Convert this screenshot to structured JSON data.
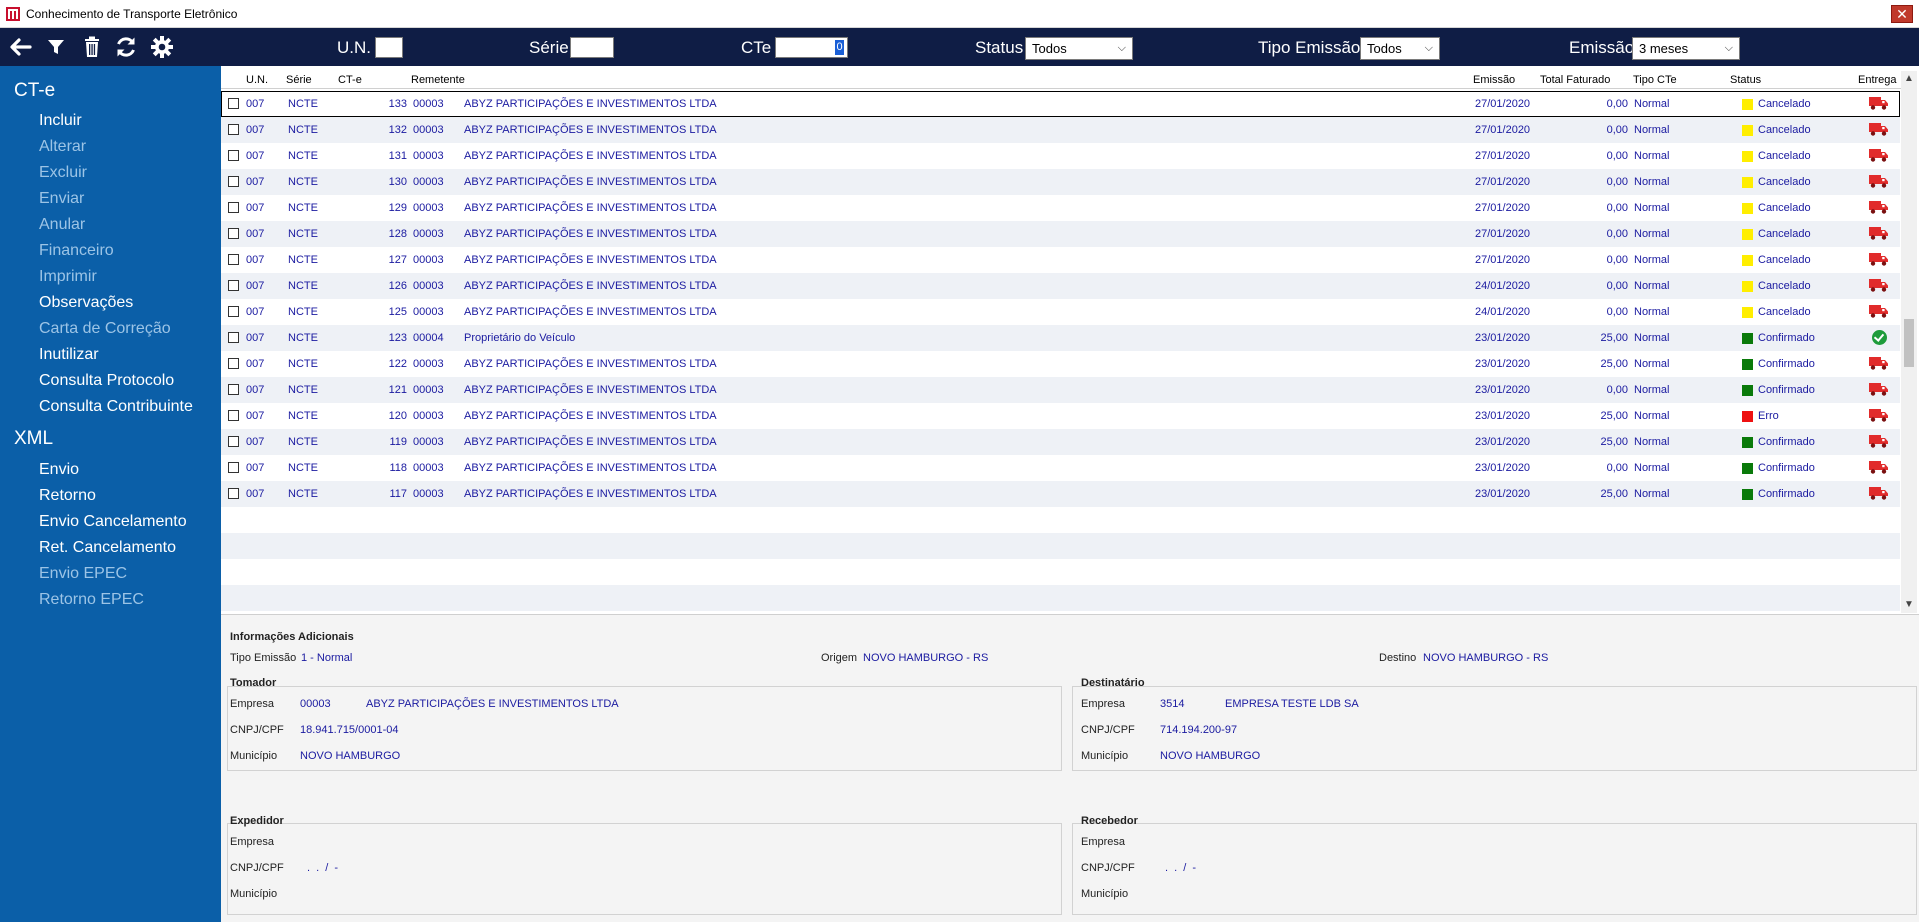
{
  "window": {
    "title": "Conhecimento de Transporte Eletrônico",
    "close_glyph": "✕"
  },
  "toolbar": {
    "icons": [
      "back-arrow-icon",
      "filter-icon",
      "trash-icon",
      "refresh-icon",
      "gear-icon"
    ],
    "un_label": "U.N.",
    "un_value": "",
    "serie_label": "Série",
    "serie_value": "",
    "cte_label": "CTe",
    "cte_value": "0",
    "status_label": "Status",
    "status_value": "Todos",
    "tipo_label": "Tipo Emissão",
    "tipo_value": "Todos",
    "emissao_label": "Emissão",
    "emissao_value": "3 meses"
  },
  "sidebar": {
    "cte_title": "CT-e",
    "cte_items": [
      {
        "label": "Incluir",
        "enabled": true
      },
      {
        "label": "Alterar",
        "enabled": false
      },
      {
        "label": "Excluir",
        "enabled": false
      },
      {
        "label": "Enviar",
        "enabled": false
      },
      {
        "label": "Anular",
        "enabled": false
      },
      {
        "label": "Financeiro",
        "enabled": false
      },
      {
        "label": "Imprimir",
        "enabled": false
      },
      {
        "label": "Observações",
        "enabled": true
      },
      {
        "label": "Carta de Correção",
        "enabled": false
      },
      {
        "label": "Inutilizar",
        "enabled": true
      },
      {
        "label": "Consulta Protocolo",
        "enabled": true
      },
      {
        "label": "Consulta Contribuinte",
        "enabled": true
      }
    ],
    "xml_title": "XML",
    "xml_items": [
      {
        "label": "Envio",
        "enabled": true
      },
      {
        "label": "Retorno",
        "enabled": true
      },
      {
        "label": "Envio Cancelamento",
        "enabled": true
      },
      {
        "label": "Ret. Cancelamento",
        "enabled": true
      },
      {
        "label": "Envio EPEC",
        "enabled": false
      },
      {
        "label": "Retorno EPEC",
        "enabled": false
      }
    ]
  },
  "grid": {
    "columns": [
      "U.N.",
      "Série",
      "CT-e",
      "Remetente",
      "Emissão",
      "Total Faturado",
      "Tipo CTe",
      "Status",
      "Entrega"
    ],
    "status_colors": {
      "Cancelado": "#ffee00",
      "Confirmado": "#0a7a0a",
      "Erro": "#ee1111"
    },
    "rows": [
      {
        "un": "007",
        "serie": "NCTE",
        "cte": "133",
        "code": "00003",
        "name": "ABYZ PARTICIPAÇÕES E INVESTIMENTOS LTDA",
        "emissao": "27/01/2020",
        "total": "0,00",
        "tipo": "Normal",
        "status": "Cancelado",
        "entrega": "truck"
      },
      {
        "un": "007",
        "serie": "NCTE",
        "cte": "132",
        "code": "00003",
        "name": "ABYZ PARTICIPAÇÕES E INVESTIMENTOS LTDA",
        "emissao": "27/01/2020",
        "total": "0,00",
        "tipo": "Normal",
        "status": "Cancelado",
        "entrega": "truck"
      },
      {
        "un": "007",
        "serie": "NCTE",
        "cte": "131",
        "code": "00003",
        "name": "ABYZ PARTICIPAÇÕES E INVESTIMENTOS LTDA",
        "emissao": "27/01/2020",
        "total": "0,00",
        "tipo": "Normal",
        "status": "Cancelado",
        "entrega": "truck"
      },
      {
        "un": "007",
        "serie": "NCTE",
        "cte": "130",
        "code": "00003",
        "name": "ABYZ PARTICIPAÇÕES E INVESTIMENTOS LTDA",
        "emissao": "27/01/2020",
        "total": "0,00",
        "tipo": "Normal",
        "status": "Cancelado",
        "entrega": "truck"
      },
      {
        "un": "007",
        "serie": "NCTE",
        "cte": "129",
        "code": "00003",
        "name": "ABYZ PARTICIPAÇÕES E INVESTIMENTOS LTDA",
        "emissao": "27/01/2020",
        "total": "0,00",
        "tipo": "Normal",
        "status": "Cancelado",
        "entrega": "truck"
      },
      {
        "un": "007",
        "serie": "NCTE",
        "cte": "128",
        "code": "00003",
        "name": "ABYZ PARTICIPAÇÕES E INVESTIMENTOS LTDA",
        "emissao": "27/01/2020",
        "total": "0,00",
        "tipo": "Normal",
        "status": "Cancelado",
        "entrega": "truck"
      },
      {
        "un": "007",
        "serie": "NCTE",
        "cte": "127",
        "code": "00003",
        "name": "ABYZ PARTICIPAÇÕES E INVESTIMENTOS LTDA",
        "emissao": "27/01/2020",
        "total": "0,00",
        "tipo": "Normal",
        "status": "Cancelado",
        "entrega": "truck"
      },
      {
        "un": "007",
        "serie": "NCTE",
        "cte": "126",
        "code": "00003",
        "name": "ABYZ PARTICIPAÇÕES E INVESTIMENTOS LTDA",
        "emissao": "24/01/2020",
        "total": "0,00",
        "tipo": "Normal",
        "status": "Cancelado",
        "entrega": "truck"
      },
      {
        "un": "007",
        "serie": "NCTE",
        "cte": "125",
        "code": "00003",
        "name": "ABYZ PARTICIPAÇÕES E INVESTIMENTOS LTDA",
        "emissao": "24/01/2020",
        "total": "0,00",
        "tipo": "Normal",
        "status": "Cancelado",
        "entrega": "truck"
      },
      {
        "un": "007",
        "serie": "NCTE",
        "cte": "123",
        "code": "00004",
        "name": "Proprietário do Veículo",
        "emissao": "23/01/2020",
        "total": "25,00",
        "tipo": "Normal",
        "status": "Confirmado",
        "entrega": "ok"
      },
      {
        "un": "007",
        "serie": "NCTE",
        "cte": "122",
        "code": "00003",
        "name": "ABYZ PARTICIPAÇÕES E INVESTIMENTOS LTDA",
        "emissao": "23/01/2020",
        "total": "25,00",
        "tipo": "Normal",
        "status": "Confirmado",
        "entrega": "truck"
      },
      {
        "un": "007",
        "serie": "NCTE",
        "cte": "121",
        "code": "00003",
        "name": "ABYZ PARTICIPAÇÕES E INVESTIMENTOS LTDA",
        "emissao": "23/01/2020",
        "total": "0,00",
        "tipo": "Normal",
        "status": "Confirmado",
        "entrega": "truck"
      },
      {
        "un": "007",
        "serie": "NCTE",
        "cte": "120",
        "code": "00003",
        "name": "ABYZ PARTICIPAÇÕES E INVESTIMENTOS LTDA",
        "emissao": "23/01/2020",
        "total": "25,00",
        "tipo": "Normal",
        "status": "Erro",
        "entrega": "truck"
      },
      {
        "un": "007",
        "serie": "NCTE",
        "cte": "119",
        "code": "00003",
        "name": "ABYZ PARTICIPAÇÕES E INVESTIMENTOS LTDA",
        "emissao": "23/01/2020",
        "total": "25,00",
        "tipo": "Normal",
        "status": "Confirmado",
        "entrega": "truck"
      },
      {
        "un": "007",
        "serie": "NCTE",
        "cte": "118",
        "code": "00003",
        "name": "ABYZ PARTICIPAÇÕES E INVESTIMENTOS LTDA",
        "emissao": "23/01/2020",
        "total": "0,00",
        "tipo": "Normal",
        "status": "Confirmado",
        "entrega": "truck"
      },
      {
        "un": "007",
        "serie": "NCTE",
        "cte": "117",
        "code": "00003",
        "name": "ABYZ PARTICIPAÇÕES E INVESTIMENTOS LTDA",
        "emissao": "23/01/2020",
        "total": "25,00",
        "tipo": "Normal",
        "status": "Confirmado",
        "entrega": "truck"
      }
    ]
  },
  "details": {
    "info_title": "Informações Adicionais",
    "tipo_emissao_label": "Tipo Emissão",
    "tipo_emissao_value": "1 - Normal",
    "origem_label": "Origem",
    "origem_value": "NOVO HAMBURGO - RS",
    "destino_label": "Destino",
    "destino_value": "NOVO HAMBURGO - RS",
    "empresa_label": "Empresa",
    "cnpj_label": "CNPJ/CPF",
    "municipio_label": "Município",
    "tomador": {
      "title": "Tomador",
      "empresa_code": "00003",
      "empresa_name": "ABYZ PARTICIPAÇÕES E INVESTIMENTOS LTDA",
      "cnpj": "18.941.715/0001-04",
      "municipio": "NOVO HAMBURGO"
    },
    "destinatario": {
      "title": "Destinatário",
      "empresa_code": "3514",
      "empresa_name": "EMPRESA TESTE LDB SA",
      "cnpj": "714.194.200-97",
      "municipio": "NOVO HAMBURGO"
    },
    "expedidor": {
      "title": "Expedidor",
      "empresa_code": "",
      "empresa_name": "",
      "cnpj": ". . / -",
      "municipio": ""
    },
    "recebedor": {
      "title": "Recebedor",
      "empresa_code": "",
      "empresa_name": "",
      "cnpj": ". . / -",
      "municipio": ""
    }
  }
}
